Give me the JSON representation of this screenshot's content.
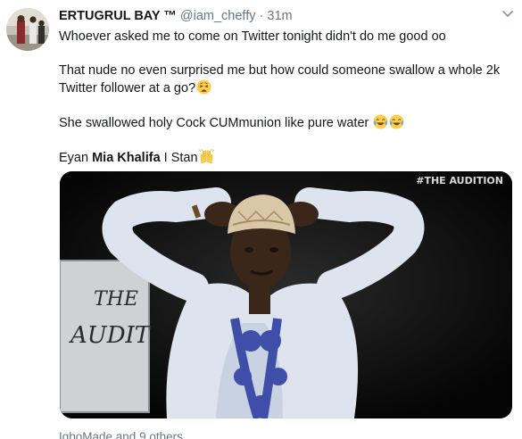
{
  "tweet": {
    "display_name": "ERTUGRUL BAY ™",
    "handle": "@iam_cheffy",
    "separator": "·",
    "timestamp": "31m",
    "lines": {
      "l1": "Whoever asked me to come on Twitter tonight didn't do me good oo",
      "l2": "That nude no even surprised me but how could someone swallow a whole 2k Twitter follower at a go?",
      "l3": "She swallowed holy Cock CUMmunion like pure water",
      "l4_prefix": "Eyan ",
      "l4_bold": "Mia Khalifa",
      "l4_suffix": " I Stan"
    },
    "emojis": {
      "l2": "weary-face-emoji",
      "l3": "face-with-tears-of-joy-emoji",
      "l4": "raising-hands-emoji"
    },
    "media": {
      "overlay_tag": "#THE AUDITION",
      "sign_text_1": "THE",
      "sign_text_2": "AUDIT"
    },
    "liked_by": "IgboMade and 9 others"
  },
  "colors": {
    "text": "#14171a",
    "muted": "#657786",
    "background": "#ffffff"
  }
}
